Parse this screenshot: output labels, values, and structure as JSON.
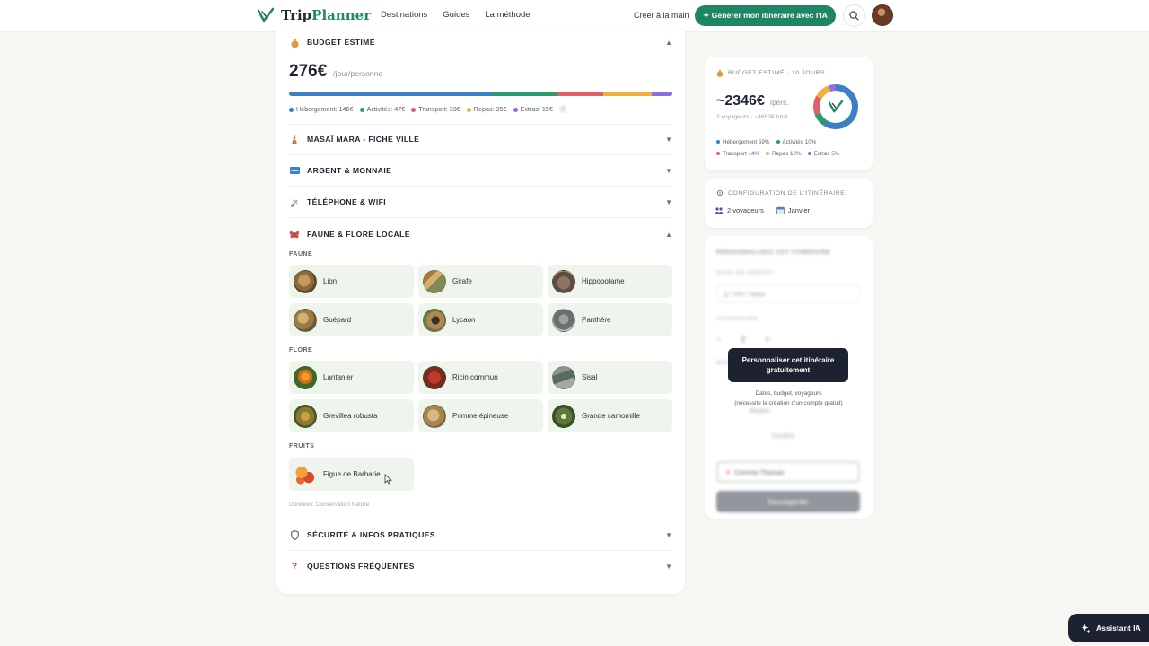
{
  "header": {
    "brand_a": "Trip",
    "brand_b": "Planner",
    "nav": [
      "Destinations",
      "Guides",
      "La méthode"
    ],
    "link": "Créer à la main",
    "cta": "✦ Générer mon itinéraire avec l'IA"
  },
  "budget": {
    "title": "BUDGET ESTIMÉ",
    "amount": "276€",
    "unit": "/jour/personne",
    "segments": [
      {
        "label": "Hébergement: 146€",
        "value": 146,
        "color": "#3b7fc4"
      },
      {
        "label": "Activités: 47€",
        "value": 47,
        "color": "#2a9d6f"
      },
      {
        "label": "Transport: 33€",
        "value": 33,
        "color": "#e0606a"
      },
      {
        "label": "Repas: 35€",
        "value": 35,
        "color": "#f0b040"
      },
      {
        "label": "Extras: 15€",
        "value": 15,
        "color": "#8b6fe0"
      }
    ],
    "info": "i"
  },
  "sections": {
    "city": "MASAÏ MARA - FICHE VILLE",
    "money": "ARGENT & MONNAIE",
    "phone": "TÉLÉPHONE & WIFI",
    "wildlife": "FAUNE & FLORE LOCALE",
    "safety": "SÉCURITÉ & INFOS PRATIQUES",
    "faq": "QUESTIONS FRÉQUENTES"
  },
  "wildlife": {
    "fauna_label": "FAUNE",
    "flora_label": "FLORE",
    "fruits_label": "FRUITS",
    "fauna": [
      "Lion",
      "Girafe",
      "Hippopotame",
      "Guépard",
      "Lycaon",
      "Panthère"
    ],
    "flora": [
      "Lantanier",
      "Ricin commun",
      "Sisal",
      "Grevillea robusta",
      "Pomme épineuse",
      "Grande camomille"
    ],
    "fruits": [
      "Figue de Barbarie"
    ],
    "source": "Données: Conservation Nature"
  },
  "summary": {
    "title": "BUDGET ESTIMÉ · 10 JOURS",
    "total": "~2346€",
    "unit": "/pers.",
    "sub": "2 voyageurs · ~4692€ total",
    "legend": [
      {
        "label": "Hébergement 59%",
        "pct": 59,
        "color": "#3b7fc4"
      },
      {
        "label": "Activités 10%",
        "pct": 10,
        "color": "#2a9d6f"
      },
      {
        "label": "Transport 14%",
        "pct": 14,
        "color": "#e0606a"
      },
      {
        "label": "Repas 12%",
        "pct": 12,
        "color": "#f0b040"
      },
      {
        "label": "Extras 5%",
        "pct": 5,
        "color": "#8b6fe0"
      }
    ]
  },
  "config": {
    "title": "CONFIGURATION DE L'ITINÉRAIRE",
    "travelers": "2 voyageurs",
    "month": "Janvier"
  },
  "personalize": {
    "title": "PERSONNALISEZ CET ITINÉRAIRE",
    "date_label": "DATE DE DÉPART",
    "date_placeholder": "jj / mm / aaaa",
    "travelers_label": "VOYAGEURS",
    "travelers_value": "2",
    "minus": "−",
    "plus": "+",
    "budget_label": "BUDGET",
    "opt1": "Moyen",
    "opt2": "Confort",
    "mood_value": "Comme Thomas",
    "save": "Sauvegarder",
    "overlay_btn": "Personnaliser cet itinéraire gratuitement",
    "overlay_sub1": "Dates, budget, voyageurs",
    "overlay_sub2": "(nécessite la création d'un compte gratuit)"
  },
  "assistant": {
    "label": "Assistant IA"
  }
}
